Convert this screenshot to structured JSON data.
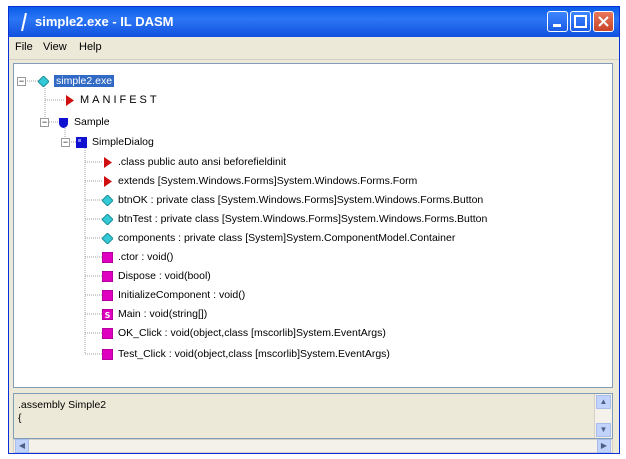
{
  "window": {
    "title": "simple2.exe - IL DASM"
  },
  "menu": {
    "file": "File",
    "view": "View",
    "help": "Help"
  },
  "tree": {
    "root": "simple2.exe",
    "manifest": "MANIFEST",
    "namespace": "Sample",
    "class": "SimpleDialog",
    "members": [
      ".class public auto ansi beforefieldinit",
      "extends [System.Windows.Forms]System.Windows.Forms.Form",
      "btnOK : private class [System.Windows.Forms]System.Windows.Forms.Button",
      "btnTest : private class [System.Windows.Forms]System.Windows.Forms.Button",
      "components : private class [System]System.ComponentModel.Container",
      ".ctor : void()",
      "Dispose : void(bool)",
      "InitializeComponent : void()",
      "Main : void(string[])",
      "OK_Click : void(object,class [mscorlib]System.EventArgs)",
      "Test_Click : void(object,class [mscorlib]System.EventArgs)"
    ]
  },
  "info": {
    "text": ".assembly Simple2\n{"
  },
  "colors": {
    "titlebar": "#0a5ce8",
    "selection": "#316ac5",
    "method": "#e000c0",
    "field": "#33c9d6",
    "class": "#1010d0",
    "arrow": "#d01010"
  }
}
